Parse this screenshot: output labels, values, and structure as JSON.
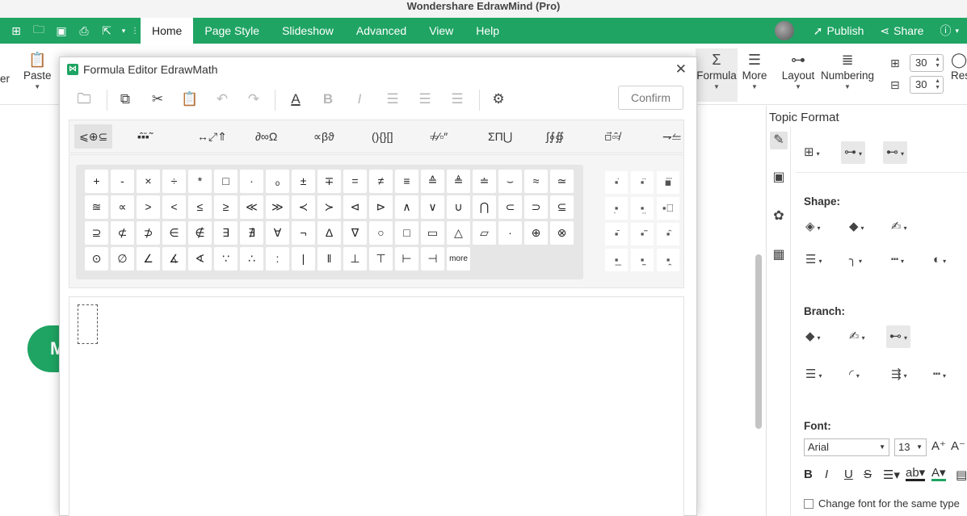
{
  "window": {
    "title": "Wondershare EdrawMind (Pro)"
  },
  "menu": {
    "tabs": [
      "Home",
      "Page Style",
      "Slideshow",
      "Advanced",
      "View",
      "Help"
    ],
    "publish": "Publish",
    "share": "Share"
  },
  "ribbon": {
    "left_cut": "er",
    "paste": "Paste",
    "formula": "Formula",
    "more": "More",
    "layout": "Layout",
    "numbering": "Numbering",
    "spacing_h": "30",
    "spacing_v": "30",
    "right_cut": "Res"
  },
  "canvas": {
    "node_label": "M"
  },
  "dialog": {
    "title": "Formula Editor EdrawMath",
    "confirm": "Confirm",
    "categories": [
      "⩽⊕⊆",
      "▪̂▪̄▪̃",
      "↔⤢⇑",
      "∂∞Ω",
      "∝βϑ",
      "(){}[]",
      "▫̸▫⁄▫″",
      "ΣΠ⋃",
      "∫∮∯",
      "▫⃗▫̂▫̸",
      "⇁⥪"
    ],
    "symbols": [
      [
        "+",
        "-",
        "×",
        "÷",
        "*",
        "□",
        "·",
        "ₒ",
        "±",
        "∓",
        "=",
        "≠",
        "≡",
        "≙",
        "≜",
        "≐",
        "⌣",
        "≈",
        "≃"
      ],
      [
        "≊",
        "∝",
        ">",
        "<",
        "≤",
        "≥",
        "≪",
        "≫",
        "≺",
        "≻",
        "⊲",
        "⊳",
        "∧",
        "∨",
        "∪",
        "⋂",
        "⊂",
        "⊃",
        "⊆"
      ],
      [
        "⊇",
        "⊄",
        "⊅",
        "∈",
        "∉",
        "∃",
        "∄",
        "∀",
        "¬",
        "Δ",
        "∇",
        "○",
        "□",
        "▭",
        "△",
        "▱",
        "·",
        "⊕",
        "⊗"
      ],
      [
        "⊙",
        "∅",
        "∠",
        "∡",
        "∢",
        "∵",
        "∴",
        ":",
        "|",
        "‖",
        "⊥",
        "⊤",
        "⊢",
        "⊣",
        "more"
      ]
    ],
    "accents": [
      [
        "▪̇",
        "▪̈",
        "▪⃛"
      ],
      [
        "▪̣",
        "▪̤",
        "▪⃨"
      ],
      [
        "▪̄",
        "▪̃",
        "▪̂"
      ],
      [
        "▪̲",
        "▪̰",
        "▪̭"
      ]
    ]
  },
  "panel": {
    "title": "Topic Format",
    "shape_label": "Shape:",
    "branch_label": "Branch:",
    "font_label": "Font:",
    "font_family": "Arial",
    "font_size": "13",
    "change_font_label": "Change font for the same type"
  },
  "colors": {
    "accent": "#1fa463",
    "menu_text": "#ffffff"
  }
}
